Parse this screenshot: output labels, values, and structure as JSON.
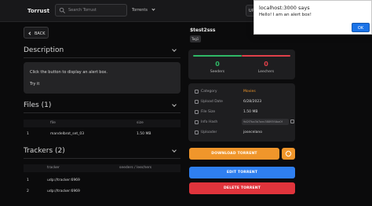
{
  "header": {
    "brand": "Torrust",
    "search_placeholder": "Search Torrust",
    "nav_torrents": "Torrents",
    "user_label": "UP"
  },
  "back_label": "BACK",
  "description": {
    "title": "Description",
    "text_line1": "Click the button to display an alert box.",
    "text_line2": "Try it"
  },
  "files": {
    "title": "Files (1)",
    "columns": [
      "file",
      "size"
    ],
    "rows": [
      {
        "index": "1",
        "name": "mandelbrot_set_03",
        "size": "1.50 MB"
      }
    ]
  },
  "trackers": {
    "title": "Trackers (2)",
    "columns": [
      "tracker",
      "seeders / leechers"
    ],
    "rows": [
      {
        "index": "1",
        "url": "udp://tracker:6969"
      },
      {
        "index": "2",
        "url": "udp://tracker:6969"
      }
    ]
  },
  "torrent": {
    "title": "$test2sss",
    "tag": "Tag1",
    "seeders_count": "0",
    "seeders_label": "Seeders",
    "leechers_count": "0",
    "leechers_label": "Leechers",
    "info": [
      {
        "key": "Category",
        "value": "Movies"
      },
      {
        "key": "Upload Date",
        "value": "6/28/2023"
      },
      {
        "key": "File Size",
        "value": "1.50 MB"
      },
      {
        "key": "Info Hash",
        "value": "9d2f7ba3b7aec38893f4ba0f"
      },
      {
        "key": "Uploader",
        "value": "josecelano"
      }
    ]
  },
  "actions": {
    "download": "DOWNLOAD TORRENT",
    "edit": "EDIT TORRENT",
    "delete": "DELETE TORRENT"
  },
  "alert": {
    "title": "localhost:3000 says",
    "message": "Hello! I am an alert box!",
    "ok": "OK"
  },
  "colors": {
    "accent_orange": "#f0962b",
    "seeders_green": "#2fb866",
    "leechers_red": "#e0404a",
    "edit_blue": "#2f7ff0",
    "delete_red": "#e0343c"
  }
}
